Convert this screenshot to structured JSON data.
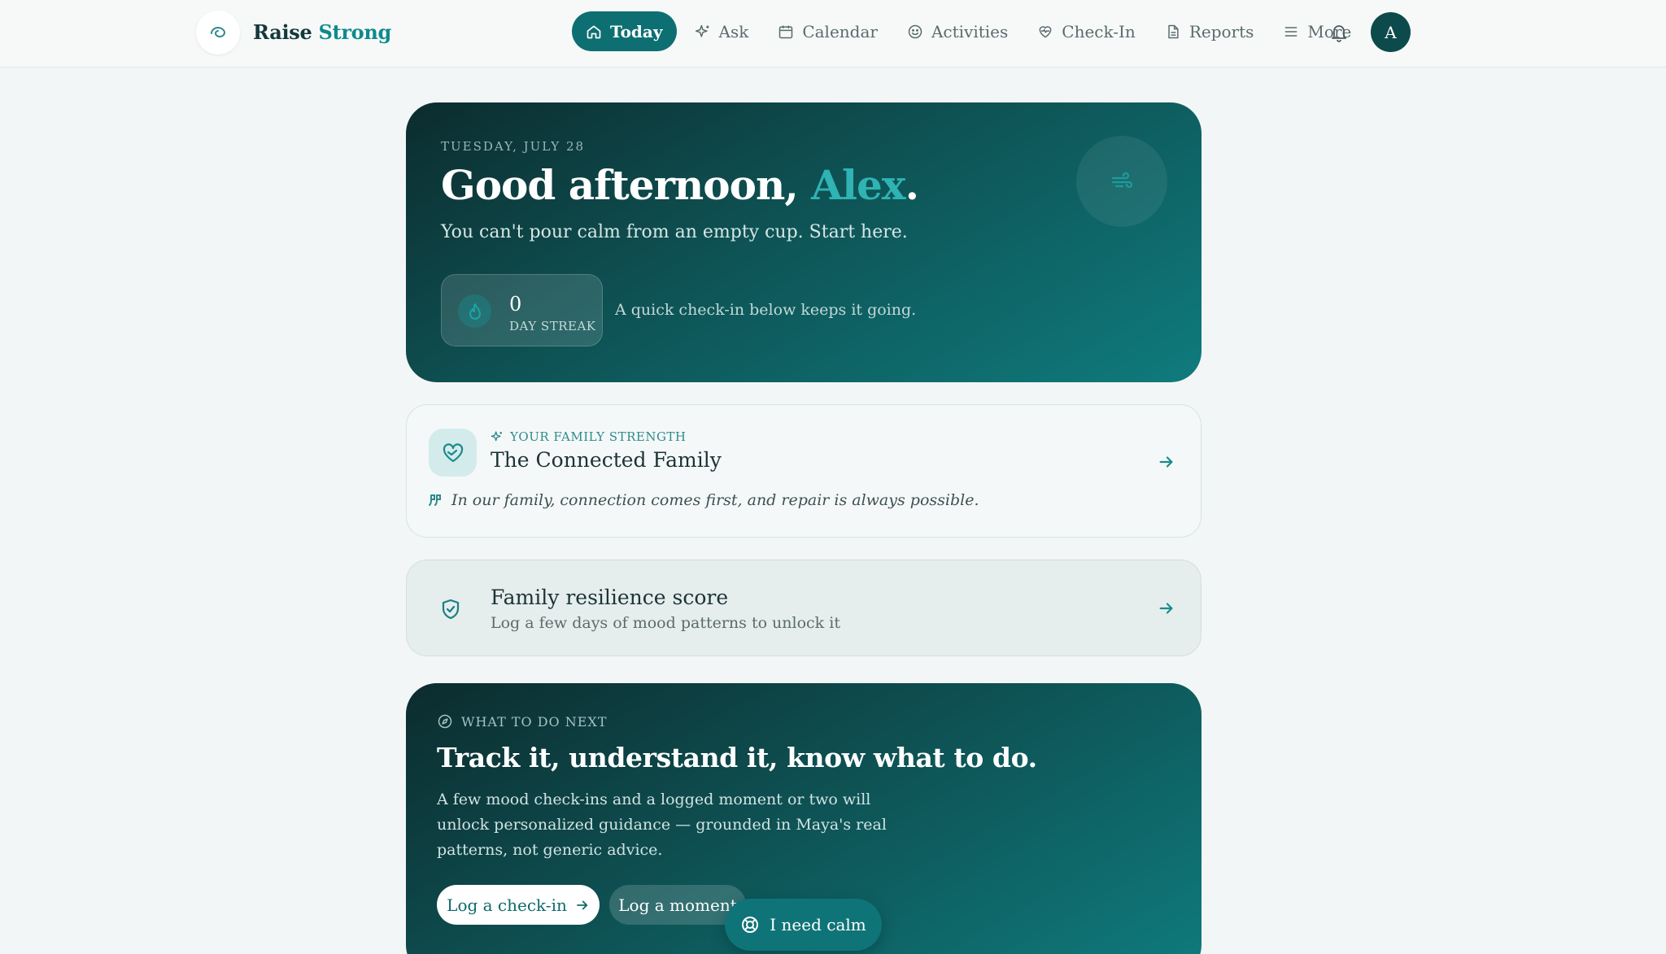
{
  "brand": {
    "name_main": "Raise",
    "name_accent": "Strong",
    "logo_icon": "swirl-icon"
  },
  "nav": {
    "items": [
      {
        "label": "Today",
        "icon": "home-icon",
        "active": true
      },
      {
        "label": "Ask",
        "icon": "sparkle-icon"
      },
      {
        "label": "Calendar",
        "icon": "calendar-icon"
      },
      {
        "label": "Activities",
        "icon": "smile-icon"
      },
      {
        "label": "Check-In",
        "icon": "heart-pulse-icon"
      },
      {
        "label": "Reports",
        "icon": "file-icon"
      },
      {
        "label": "More",
        "icon": "menu-icon"
      }
    ],
    "notifications_icon": "bell-icon",
    "avatar_initial": "A"
  },
  "hero": {
    "date": "TUESDAY, JULY 28",
    "greeting_prefix": "Good afternoon, ",
    "greeting_name": "Alex",
    "greeting_suffix": ".",
    "subtitle": "You can't pour calm from an empty cup. Start here.",
    "orb_icon": "wind-icon",
    "streak": {
      "count": "0",
      "label": "DAY STREAK",
      "icon": "flame-icon"
    },
    "streak_note": "A quick check-in below keeps it going."
  },
  "strength": {
    "eyebrow": "YOUR FAMILY STRENGTH",
    "title": "The Connected Family",
    "quote": "In our family, connection comes first, and repair is always possible."
  },
  "resilience": {
    "title": "Family resilience score",
    "subtitle": "Log a few days of mood patterns to unlock it"
  },
  "next": {
    "eyebrow": "WHAT TO DO NEXT",
    "title": "Track it, understand it, know what to do.",
    "body": "A few mood check-ins and a logged moment or two will unlock personalized guidance — grounded in Maya's real patterns, not generic advice.",
    "primary_label": "Log a check-in",
    "secondary_label": "Log a moment"
  },
  "calm": {
    "label": "I need calm",
    "icon": "lifebuoy-icon"
  },
  "colors": {
    "accent": "#0f7477",
    "brand": "#0f8a8c",
    "dark_teal": "#0c2c2e",
    "page_bg": "#f3f6f6"
  }
}
